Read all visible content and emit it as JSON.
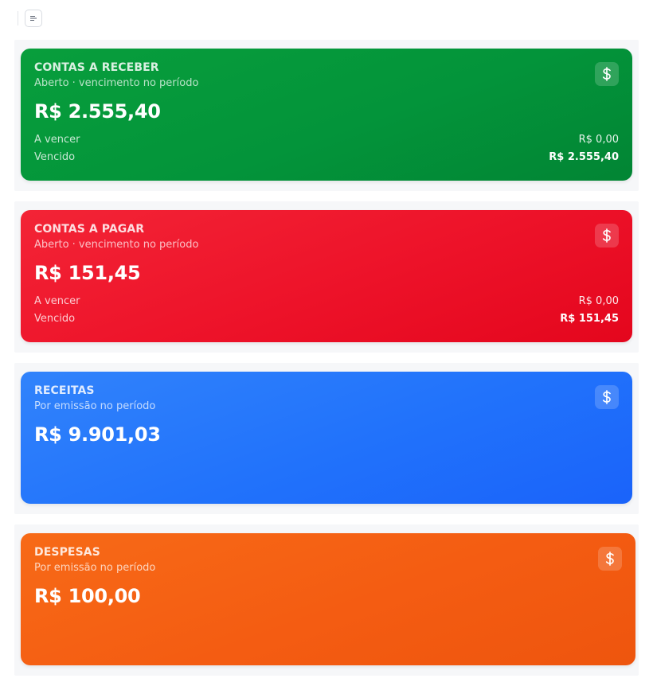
{
  "toolbar": {
    "menu_icon": "menu-icon"
  },
  "cards": [
    {
      "title": "CONTAS A RECEBER",
      "subtitle": "Aberto · vencimento no período",
      "amount": "R$ 2.555,40",
      "icon": "dollar-icon",
      "color": "#039a3b",
      "rows": [
        {
          "label": "A vencer",
          "value": "R$ 0,00"
        },
        {
          "label": "Vencido",
          "value": "R$ 2.555,40"
        }
      ]
    },
    {
      "title": "CONTAS A PAGAR",
      "subtitle": "Aberto · vencimento no período",
      "amount": "R$ 151,45",
      "icon": "dollar-icon",
      "color": "#ee1529",
      "rows": [
        {
          "label": "A vencer",
          "value": "R$ 0,00"
        },
        {
          "label": "Vencido",
          "value": "R$ 151,45"
        }
      ]
    },
    {
      "title": "RECEITAS",
      "subtitle": "Por emissão no período",
      "amount": "R$ 9.901,03",
      "icon": "dollar-icon",
      "color": "#2272fb"
    },
    {
      "title": "DESPESAS",
      "subtitle": "Por emissão no período",
      "amount": "R$ 100,00",
      "icon": "dollar-icon",
      "color": "#f45d12"
    }
  ]
}
